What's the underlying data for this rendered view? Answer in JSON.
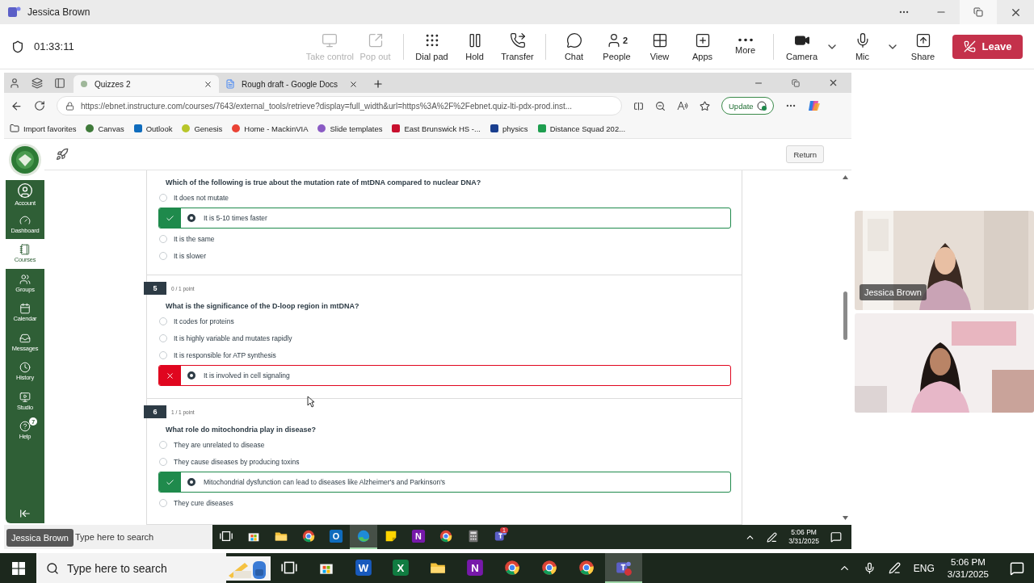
{
  "teams": {
    "title": "Jessica Brown",
    "timer": "01:33:11",
    "tool_groups": [
      [
        {
          "label": "Take control",
          "kind": "monitor",
          "disabled": true
        },
        {
          "label": "Pop out",
          "kind": "popout",
          "disabled": true
        }
      ],
      [
        {
          "label": "Dial pad",
          "kind": "dialpad",
          "disabled": false
        },
        {
          "label": "Hold",
          "kind": "hold",
          "disabled": false
        },
        {
          "label": "Transfer",
          "kind": "transfer",
          "disabled": false
        }
      ],
      [
        {
          "label": "Chat",
          "kind": "chat",
          "disabled": false
        },
        {
          "label": "People",
          "kind": "people",
          "count": "2",
          "disabled": false
        },
        {
          "label": "View",
          "kind": "view",
          "disabled": false
        },
        {
          "label": "Apps",
          "kind": "apps",
          "disabled": false
        },
        {
          "label": "More",
          "kind": "more",
          "disabled": false
        }
      ],
      [
        {
          "label": "Camera",
          "kind": "camera",
          "dropdown": true,
          "disabled": false
        },
        {
          "label": "Mic",
          "kind": "mic",
          "dropdown": true,
          "disabled": false
        },
        {
          "label": "Share",
          "kind": "share",
          "disabled": false
        }
      ]
    ],
    "leave": "Leave"
  },
  "browser": {
    "tabs": [
      {
        "title": "Quizzes 2",
        "kind": "canvas",
        "selected": true
      },
      {
        "title": "Rough draft - Google Docs",
        "kind": "docs",
        "selected": false
      }
    ],
    "url": "https://ebnet.instructure.com/courses/7643/external_tools/retrieve?display=full_width&url=https%3A%2F%2Febnet.quiz-lti-pdx-prod.inst...",
    "update": "Update",
    "bookmarks": [
      {
        "label": "Import favorites",
        "kind": "folder"
      },
      {
        "label": "Canvas",
        "kind": "dot",
        "color": "#3f7a3a"
      },
      {
        "label": "Outlook",
        "kind": "square",
        "color": "#0f6cbd"
      },
      {
        "label": "Genesis",
        "kind": "dot",
        "color": "#b8c62a"
      },
      {
        "label": "Home - MackinVIA",
        "kind": "dot",
        "color": "#ea4335"
      },
      {
        "label": "Slide templates",
        "kind": "dot",
        "color": "#8a5bc4"
      },
      {
        "label": "East Brunswick HS -...",
        "kind": "square",
        "color": "#c8102e"
      },
      {
        "label": "physics",
        "kind": "square",
        "color": "#1a3f8f"
      },
      {
        "label": "Distance Squad 202...",
        "kind": "square",
        "color": "#1e9e4f"
      }
    ]
  },
  "canvas": {
    "nav": [
      {
        "label": "Account",
        "kind": "account",
        "selected": false
      },
      {
        "label": "Dashboard",
        "kind": "dashboard",
        "selected": false
      },
      {
        "label": "Courses",
        "kind": "courses",
        "selected": true
      },
      {
        "label": "Groups",
        "kind": "groups",
        "selected": false
      },
      {
        "label": "Calendar",
        "kind": "calendar",
        "selected": false
      },
      {
        "label": "Messages",
        "kind": "messages",
        "selected": false
      },
      {
        "label": "History",
        "kind": "history",
        "selected": false
      },
      {
        "label": "Studio",
        "kind": "studio",
        "selected": false
      },
      {
        "label": "Help",
        "kind": "help",
        "badge": "7",
        "selected": false
      }
    ],
    "return": "Return"
  },
  "questions": [
    {
      "text": "Which of the following is true about the mutation rate of mtDNA compared to nuclear DNA?",
      "correct": true,
      "answers": [
        {
          "text": "It does not mutate",
          "selected": false
        },
        {
          "text": "It is 5-10 times faster",
          "selected": true
        },
        {
          "text": "It is the same",
          "selected": false
        },
        {
          "text": "It is slower",
          "selected": false
        }
      ]
    },
    {
      "number": "5",
      "points": "0 / 1 point",
      "text": "What is the significance of the D-loop region in mtDNA?",
      "correct": false,
      "answers": [
        {
          "text": "It codes for proteins",
          "selected": false
        },
        {
          "text": "It is highly variable and mutates rapidly",
          "selected": false
        },
        {
          "text": "It is responsible for ATP synthesis",
          "selected": false
        },
        {
          "text": "It is involved in cell signaling",
          "selected": true
        }
      ]
    },
    {
      "number": "6",
      "points": "1 / 1 point",
      "text": "What role do mitochondria play in disease?",
      "correct": true,
      "answers": [
        {
          "text": "They are unrelated to disease",
          "selected": false
        },
        {
          "text": "They cause diseases by producing toxins",
          "selected": false
        },
        {
          "text": "Mitochondrial dysfunction can lead to diseases like Alzheimer's and Parkinson's",
          "selected": true
        },
        {
          "text": "They cure diseases",
          "selected": false
        }
      ]
    }
  ],
  "presenter": "Jessica Brown",
  "inner_taskbar": {
    "search": "Type here to search",
    "time": "5:06 PM",
    "date": "3/31/2025",
    "apps": [
      {
        "kind": "taskview",
        "selected": false
      },
      {
        "kind": "store",
        "selected": false
      },
      {
        "kind": "explorer",
        "selected": false
      },
      {
        "kind": "chrome",
        "selected": false
      },
      {
        "kind": "outlook",
        "glyph": "O",
        "selected": false
      },
      {
        "kind": "edge",
        "selected": true
      },
      {
        "kind": "sticky",
        "selected": false
      },
      {
        "kind": "onenote",
        "glyph": "N",
        "selected": false
      },
      {
        "kind": "chrome",
        "selected": false
      },
      {
        "kind": "calculator",
        "selected": false
      },
      {
        "kind": "teams",
        "badge": "1",
        "selected": false
      }
    ]
  },
  "videos": [
    {
      "name": "Jessica Brown",
      "kind": "picture"
    },
    {
      "kind": "picture"
    }
  ],
  "taskbar": {
    "search": "Type here to search",
    "lang": "ENG",
    "time": "5:06 PM",
    "date": "3/31/2025",
    "apps": [
      {
        "kind": "taskview",
        "selected": false
      },
      {
        "kind": "store",
        "selected": false
      },
      {
        "kind": "word",
        "glyph": "W",
        "selected": false
      },
      {
        "kind": "excel",
        "glyph": "X",
        "selected": false
      },
      {
        "kind": "explorer",
        "selected": false
      },
      {
        "kind": "onenote",
        "glyph": "N",
        "selected": false
      },
      {
        "kind": "chrome",
        "selected": false
      },
      {
        "kind": "chrome",
        "selected": false
      },
      {
        "kind": "chrome",
        "selected": false
      },
      {
        "kind": "teams",
        "selected": true
      }
    ]
  }
}
